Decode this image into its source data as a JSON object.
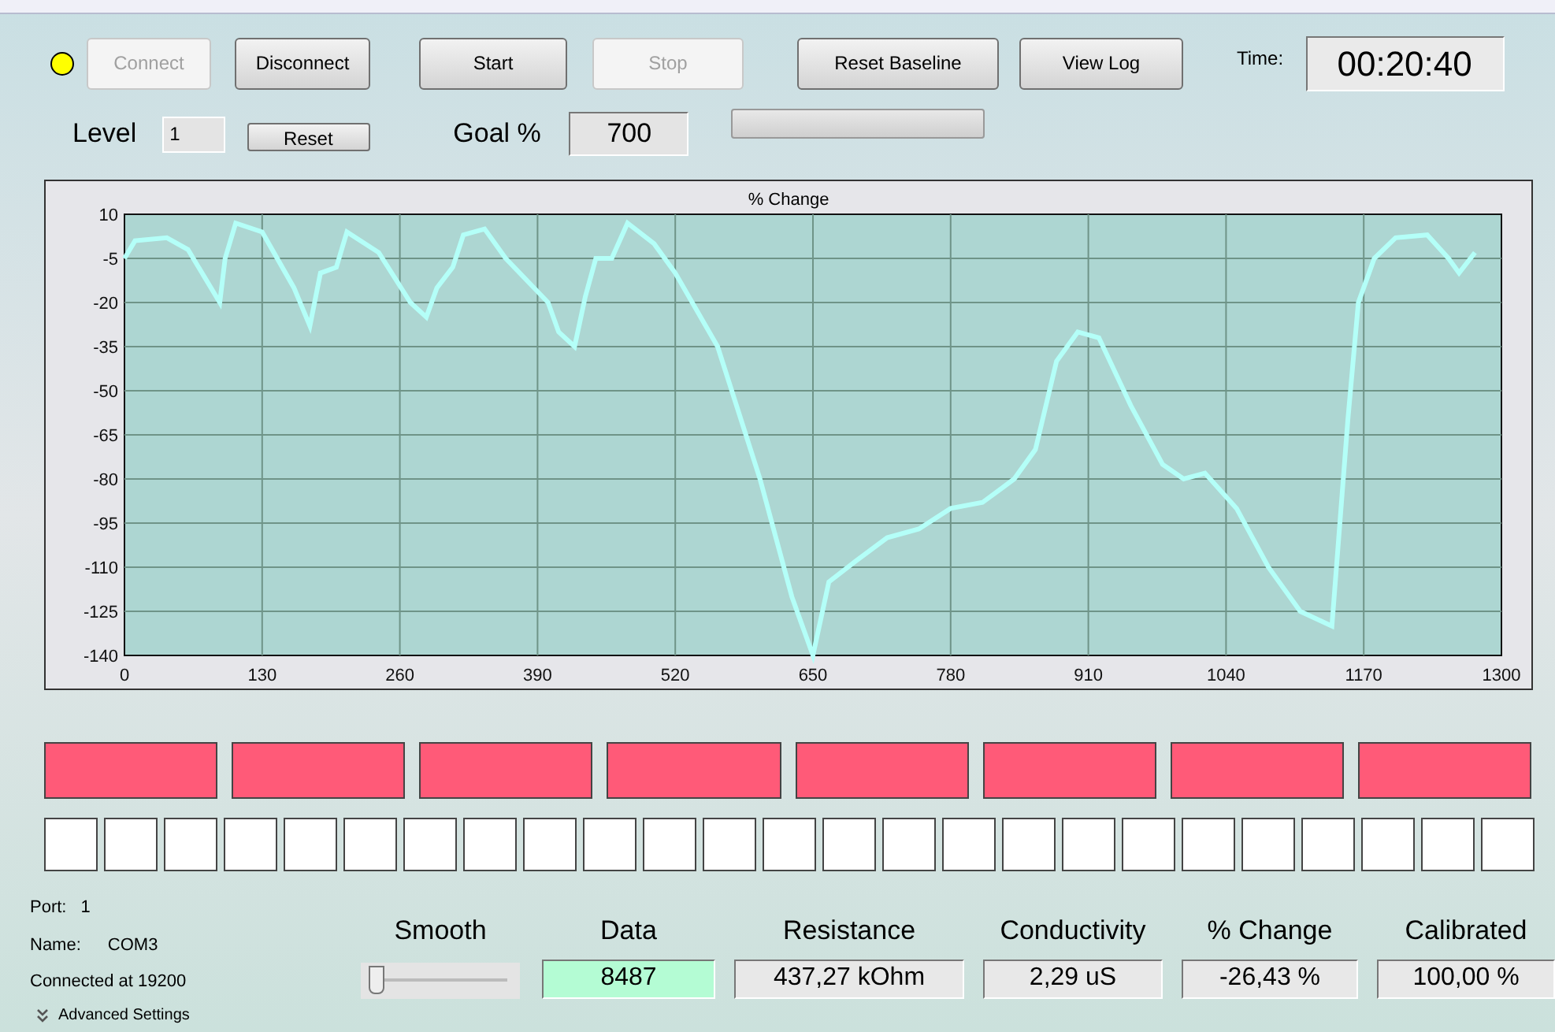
{
  "status_led": {
    "color": "#ffff00"
  },
  "buttons": [
    {
      "label": "Connect",
      "disabled": true
    },
    {
      "label": "Disconnect",
      "disabled": false
    },
    {
      "label": "Start",
      "disabled": false
    },
    {
      "label": "Stop",
      "disabled": true
    },
    {
      "label": "Reset Baseline",
      "disabled": false
    },
    {
      "label": "View Log",
      "disabled": false
    }
  ],
  "time": {
    "label": "Time:",
    "value": "00:20:40"
  },
  "level": {
    "label": "Level",
    "value": "1",
    "reset": "Reset"
  },
  "goal": {
    "label": "Goal %",
    "value": "700"
  },
  "progress": {
    "level": 0
  },
  "chart": {
    "chart_data": {
      "type": "line",
      "title": "% Change",
      "grid": true,
      "xlim": [
        0,
        1300
      ],
      "ylim": [
        -140,
        10
      ],
      "xticks": [
        0,
        130,
        260,
        390,
        520,
        650,
        780,
        910,
        1040,
        1170,
        1300
      ],
      "yticks": [
        10,
        -5,
        -20,
        -35,
        -50,
        -65,
        -80,
        -95,
        -110,
        -125,
        -140
      ],
      "x": [
        0,
        10,
        40,
        60,
        90,
        95,
        105,
        130,
        160,
        175,
        185,
        200,
        210,
        240,
        270,
        285,
        295,
        310,
        320,
        340,
        360,
        400,
        410,
        425,
        435,
        445,
        460,
        475,
        500,
        520,
        560,
        600,
        630,
        650,
        665,
        690,
        720,
        750,
        780,
        810,
        840,
        860,
        880,
        900,
        920,
        950,
        980,
        1000,
        1020,
        1050,
        1080,
        1110,
        1140,
        1155,
        1165,
        1180,
        1200,
        1230,
        1250,
        1260,
        1275
      ],
      "series": [
        {
          "color": "#b4fff8",
          "values": [
            -5,
            1,
            2,
            -2,
            -20,
            -5,
            7,
            4,
            -15,
            -28,
            -10,
            -8,
            4,
            -3,
            -20,
            -25,
            -15,
            -8,
            3,
            5,
            -5,
            -20,
            -30,
            -35,
            -18,
            -5,
            -5,
            7,
            0,
            -10,
            -35,
            -80,
            -120,
            -140,
            -115,
            -108,
            -100,
            -97,
            -90,
            -88,
            -80,
            -70,
            -40,
            -30,
            -32,
            -55,
            -75,
            -80,
            -78,
            -90,
            -110,
            -125,
            -130,
            -60,
            -20,
            -5,
            2,
            3,
            -5,
            -10,
            -3
          ]
        }
      ]
    }
  },
  "segments": [
    {
      "on": true
    },
    {
      "on": true
    },
    {
      "on": true
    },
    {
      "on": true
    },
    {
      "on": true
    },
    {
      "on": true
    },
    {
      "on": true
    },
    {
      "on": true
    }
  ],
  "cells": [
    {
      "on": false
    },
    {
      "on": false
    },
    {
      "on": false
    },
    {
      "on": false
    },
    {
      "on": false
    },
    {
      "on": false
    },
    {
      "on": false
    },
    {
      "on": false
    },
    {
      "on": false
    },
    {
      "on": false
    },
    {
      "on": false
    },
    {
      "on": false
    },
    {
      "on": false
    },
    {
      "on": false
    },
    {
      "on": false
    },
    {
      "on": false
    },
    {
      "on": false
    },
    {
      "on": false
    },
    {
      "on": false
    },
    {
      "on": false
    },
    {
      "on": false
    },
    {
      "on": false
    },
    {
      "on": false
    },
    {
      "on": false
    },
    {
      "on": false
    }
  ],
  "port": {
    "port_label": "Port:",
    "port": "1",
    "name_label": "Name:",
    "name": "COM3",
    "status": "Connected at 19200",
    "advanced": "Advanced Settings"
  },
  "smooth": {
    "label": "Smooth",
    "level": 0.05
  },
  "readouts": [
    {
      "label": "Data",
      "value": "8487",
      "highlight": true
    },
    {
      "label": "Resistance",
      "value": "437,27 kOhm",
      "highlight": false
    },
    {
      "label": "Conductivity",
      "value": "2,29 uS",
      "highlight": false
    },
    {
      "label": "% Change",
      "value": "-26,43 %",
      "highlight": false
    },
    {
      "label": "Calibrated",
      "value": "100,00 %",
      "highlight": false
    }
  ]
}
